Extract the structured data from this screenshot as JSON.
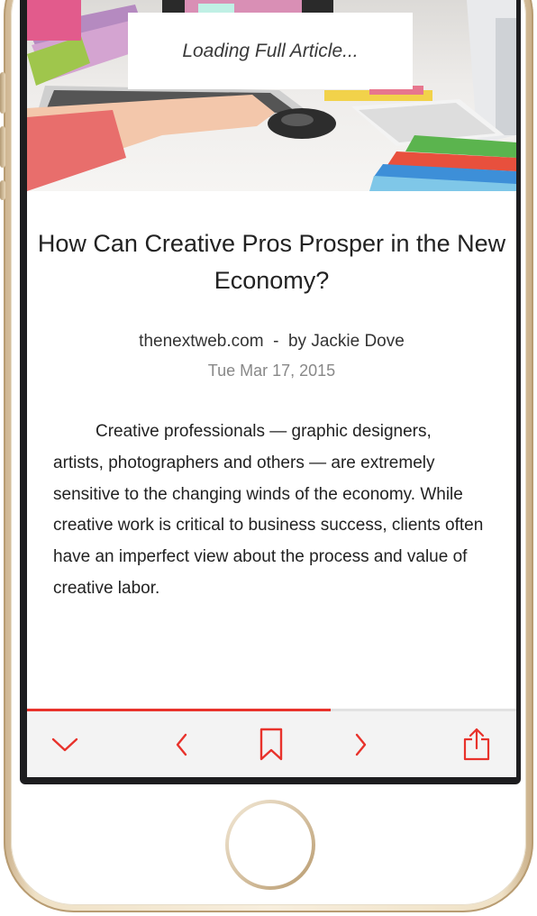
{
  "article": {
    "loading_text": "Loading Full Article...",
    "title": "How Can Creative Pros Prosper in the New Economy?",
    "source_line": "thenextweb.com  -  by Jackie Dove",
    "date": "Tue Mar 17, 2015",
    "body": "Creative professionals — graphic designers, artists, photographers and others — are extremely sensitive to the changing winds of the economy. While creative work is critical to business success, clients often have an imperfect view about the process and value of creative labor."
  },
  "toolbar": {
    "progress": 0.62,
    "accent_color": "#e8322b",
    "icons": [
      "chevron-down-icon",
      "chevron-left-icon",
      "bookmark-icon",
      "chevron-right-icon",
      "share-icon"
    ]
  }
}
